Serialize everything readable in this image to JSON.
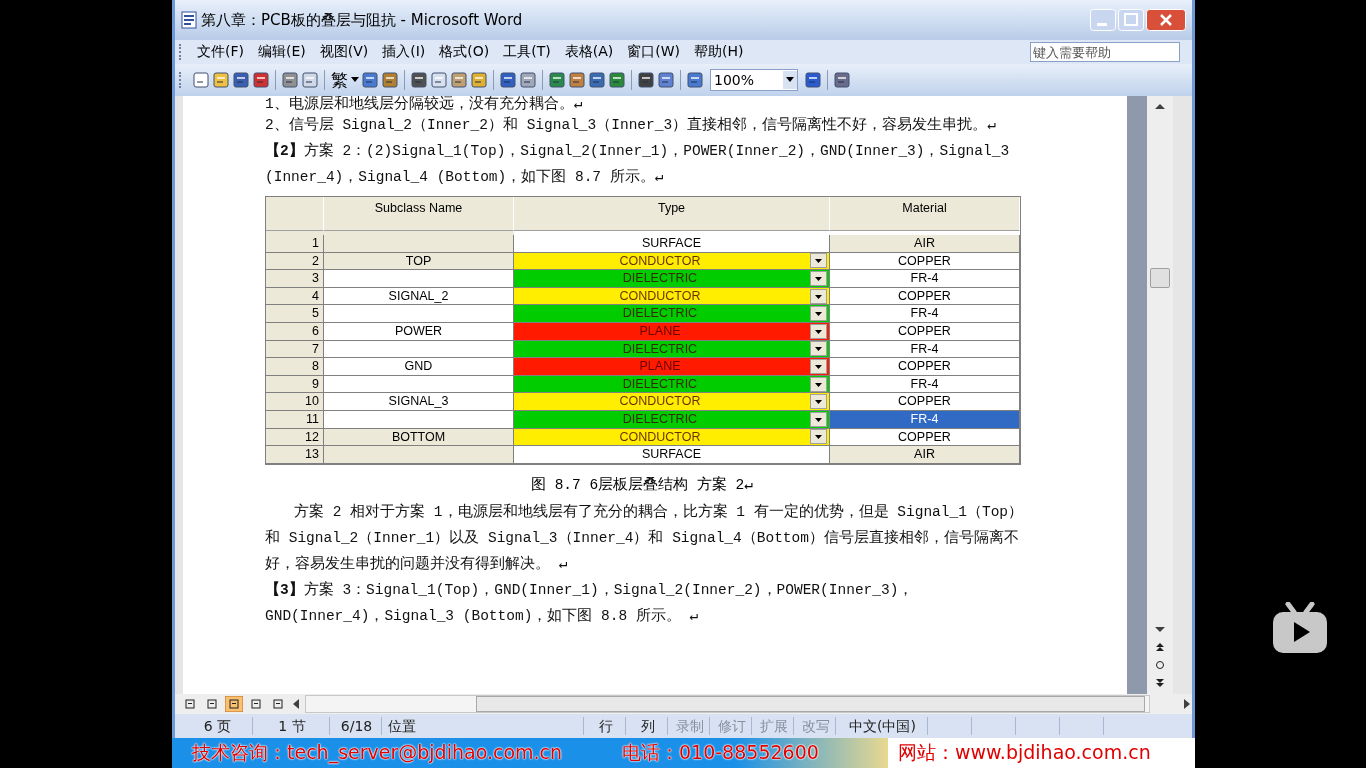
{
  "window": {
    "title": "第八章：PCB板的叠层与阻抗 - Microsoft Word"
  },
  "menu": [
    "文件(F)",
    "编辑(E)",
    "视图(V)",
    "插入(I)",
    "格式(O)",
    "工具(T)",
    "表格(A)",
    "窗口(W)",
    "帮助(H)"
  ],
  "help_box": {
    "placeholder": "键入需要帮助"
  },
  "toolbar": {
    "traditional_label": "繁",
    "zoom": "100%"
  },
  "document": {
    "paragraphs": [
      {
        "kind": "plain",
        "text": "1、电源层和地线层分隔较远，没有充分耦合。↵"
      },
      {
        "kind": "hanging",
        "text": "2、信号层 Signal_2（Inner_2）和 Signal_3（Inner_3）直接相邻，信号隔离性不好，容易发生串扰。↵"
      },
      {
        "kind": "plain",
        "text": "**【2】**方案 2：(2)Signal_1(Top)，Signal_2(Inner_1)，POWER(Inner_2)，GND(Inner_3)，Signal_3 (Inner_4)，Signal_4 (Bottom)，如下图 8.7 所示。↵"
      }
    ],
    "table": {
      "columns": [
        "Subclass Name",
        "Type",
        "Material"
      ],
      "rows": [
        {
          "num": "1",
          "kind": "surface",
          "type": "SURFACE",
          "color": "#ffffff",
          "material": "AIR",
          "shaded": true,
          "selected": false
        },
        {
          "num": "2",
          "kind": "layer",
          "name": "TOP",
          "type": "CONDUCTOR",
          "color": "#ffee00",
          "material": "COPPER",
          "shaded": true,
          "selected": false
        },
        {
          "num": "3",
          "kind": "layer",
          "type": "DIELECTRIC",
          "color": "#00cc00",
          "material": "FR-4",
          "shaded": false,
          "selected": false
        },
        {
          "num": "4",
          "kind": "layer",
          "name": "SIGNAL_2",
          "type": "CONDUCTOR",
          "color": "#ffee00",
          "material": "COPPER",
          "shaded": false,
          "selected": false
        },
        {
          "num": "5",
          "kind": "layer",
          "type": "DIELECTRIC",
          "color": "#00cc00",
          "material": "FR-4",
          "shaded": false,
          "selected": false
        },
        {
          "num": "6",
          "kind": "layer",
          "name": "POWER",
          "type": "PLANE",
          "color": "#ff1a00",
          "material": "COPPER",
          "shaded": false,
          "selected": false
        },
        {
          "num": "7",
          "kind": "layer",
          "type": "DIELECTRIC",
          "color": "#00cc00",
          "material": "FR-4",
          "shaded": false,
          "selected": false
        },
        {
          "num": "8",
          "kind": "layer",
          "name": "GND",
          "type": "PLANE",
          "color": "#ff1a00",
          "material": "COPPER",
          "shaded": false,
          "selected": false
        },
        {
          "num": "9",
          "kind": "layer",
          "type": "DIELECTRIC",
          "color": "#00cc00",
          "material": "FR-4",
          "shaded": false,
          "selected": false
        },
        {
          "num": "10",
          "kind": "layer",
          "name": "SIGNAL_3",
          "type": "CONDUCTOR",
          "color": "#ffee00",
          "material": "COPPER",
          "shaded": false,
          "selected": false
        },
        {
          "num": "11",
          "kind": "layer",
          "type": "DIELECTRIC",
          "color": "#00cc00",
          "material": "FR-4",
          "shaded": false,
          "selected": true
        },
        {
          "num": "12",
          "kind": "layer",
          "name": "BOTTOM",
          "type": "CONDUCTOR",
          "color": "#ffee00",
          "material": "COPPER",
          "shaded": true,
          "selected": false
        },
        {
          "num": "13",
          "kind": "surface",
          "type": "SURFACE",
          "color": "#ffffff",
          "material": "AIR",
          "shaded": true,
          "selected": false
        }
      ]
    },
    "caption": "图 8.7  6层板层叠结构 方案 2↵",
    "paragraphs_after": [
      {
        "kind": "indent",
        "text": "方案 2 相对于方案 1，电源层和地线层有了充分的耦合，比方案 1 有一定的优势，但是 Signal_1（Top）和 Signal_2（Inner_1）以及 Signal_3（Inner_4）和 Signal_4（Bottom）信号层直接相邻，信号隔离不好，容易发生串扰的问题并没有得到解决。 ↵"
      },
      {
        "kind": "plain",
        "text": "**【3】**方案 3：Signal_1(Top)，GND(Inner_1)，Signal_2(Inner_2)，POWER(Inner_3)，GND(Inner_4)，Signal_3 (Bottom)，如下图 8.8 所示。 ↵"
      }
    ]
  },
  "view_buttons": [
    {
      "selected": false
    },
    {
      "selected": false
    },
    {
      "selected": true
    },
    {
      "selected": false
    },
    {
      "selected": false
    }
  ],
  "status_bar": [
    {
      "text": "6 页",
      "disabled": false
    },
    {
      "text": "1 节",
      "disabled": false
    },
    {
      "text": "6/18",
      "disabled": false
    },
    {
      "text": "位置",
      "disabled": false
    },
    {
      "text": "行",
      "disabled": false
    },
    {
      "text": "列",
      "disabled": false
    },
    {
      "text": "录制",
      "disabled": true
    },
    {
      "text": "修订",
      "disabled": true
    },
    {
      "text": "扩展",
      "disabled": true
    },
    {
      "text": "改写",
      "disabled": true
    },
    {
      "text": "中文(中国)",
      "disabled": false
    }
  ],
  "banner": [
    "技术咨询：tech_server@bjdihao.com.cn",
    "电话：010-88552600",
    "网站：www.bjdihao.com.cn"
  ]
}
